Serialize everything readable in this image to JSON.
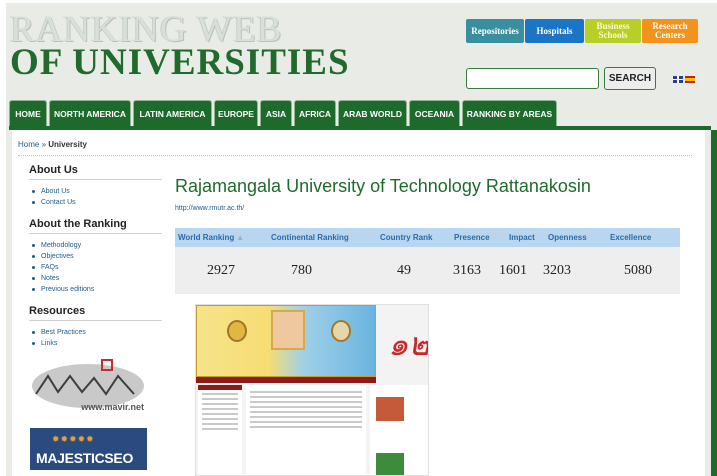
{
  "logo": {
    "line1": "RANKING WEB",
    "line2": "OF UNIVERSITIES"
  },
  "top_buttons": {
    "repositories": "Repositories",
    "hospitals": "Hospitals",
    "business": "Business Schools",
    "research": "Research Centers"
  },
  "search": {
    "button_label": "SEARCH",
    "value": ""
  },
  "nav": [
    "HOME",
    "NORTH AMERICA",
    "LATIN AMERICA",
    "EUROPE",
    "ASIA",
    "AFRICA",
    "ARAB WORLD",
    "OCEANIA",
    "RANKING BY AREAS"
  ],
  "breadcrumb": {
    "home": "Home",
    "sep": " » ",
    "current": "University"
  },
  "sidebar": {
    "about_us": {
      "title": "About Us",
      "items": [
        "About Us",
        "Contact Us"
      ]
    },
    "about_ranking": {
      "title": "About the Ranking",
      "items": [
        "Methodology",
        "Objectives",
        "FAQs",
        "Notes",
        "Previous editions"
      ]
    },
    "resources": {
      "title": "Resources",
      "items": [
        "Best Practices",
        "Links"
      ]
    }
  },
  "sponsors": {
    "mavir_url": "www.mavir.net",
    "majestic": "MAJESTICSEO"
  },
  "university": {
    "name": "Rajamangala University of Technology Rattanakosin",
    "url": "http://www.rmutr.ac.th/"
  },
  "ranking_table": {
    "headers": [
      "World Ranking",
      "Continental Ranking",
      "Country Rank",
      "Presence",
      "Impact",
      "Openness",
      "Excellence"
    ],
    "sort_arrow": "▲",
    "values": [
      "2927",
      "780",
      "49",
      "3163",
      "1601",
      "3203",
      "5080"
    ]
  },
  "colors": {
    "green": "#1d6a2c",
    "blue_link": "#1d5c86",
    "table_head": "#b9d6f0"
  }
}
